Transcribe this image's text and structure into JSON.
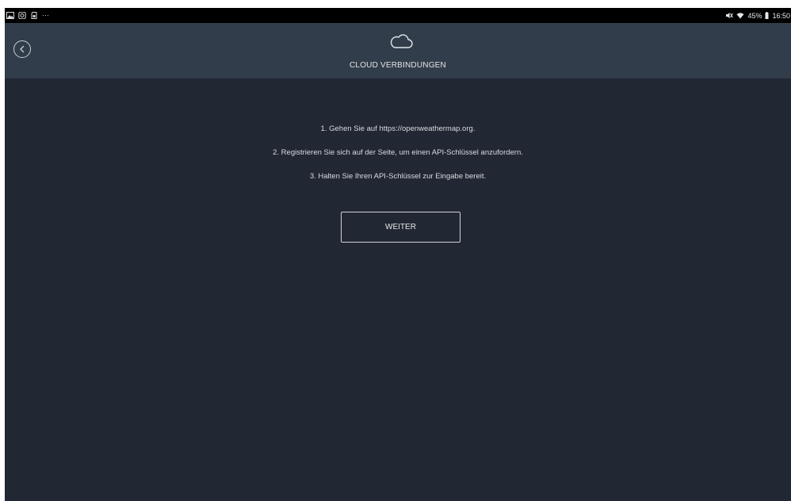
{
  "status_bar": {
    "left_icons": [
      "gallery-icon",
      "instagram-icon",
      "sd-card-icon",
      "more-dots-icon"
    ],
    "right_icons": [
      "mute-icon",
      "wifi-icon"
    ],
    "battery": "45%",
    "time": "16:50"
  },
  "header": {
    "title": "CLOUD VERBINDUNGEN",
    "back_icon": "back-arrow-circle-icon",
    "cloud_icon": "cloud-icon"
  },
  "instructions": [
    "1. Gehen Sie auf https://openweathermap.org.",
    "2. Registrieren Sie sich auf der Seite, um einen API-Schlüssel anzufordern.",
    "3. Halten Sie Ihren API-Schlüssel zur Eingabe bereit."
  ],
  "actions": {
    "next_label": "WEITER"
  },
  "colors": {
    "background": "#212733",
    "header": "#323d4b",
    "status_bar": "#000000",
    "text": "#d8dbe0"
  }
}
